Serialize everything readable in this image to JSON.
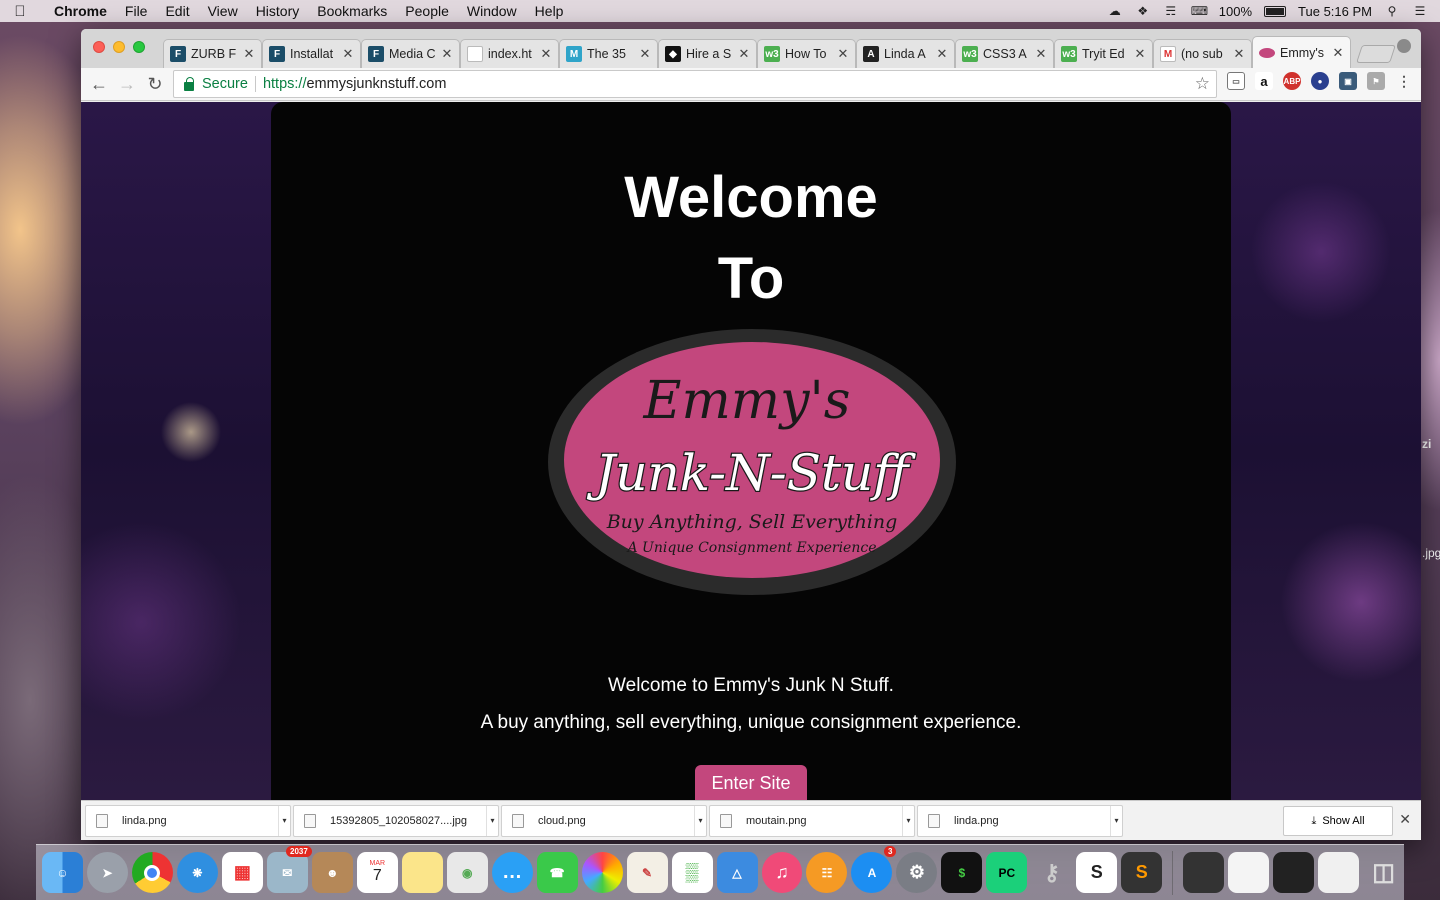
{
  "menubar": {
    "app_name": "Chrome",
    "items": [
      "File",
      "Edit",
      "View",
      "History",
      "Bookmarks",
      "People",
      "Window",
      "Help"
    ],
    "battery": "100%",
    "clock": "Tue 5:16 PM"
  },
  "tabs": [
    {
      "title": "ZURB F",
      "icon": "foundation-icon",
      "color": "#1b4d68",
      "glyph": "F"
    },
    {
      "title": "Installat",
      "icon": "foundation-icon",
      "color": "#1b4d68",
      "glyph": "F"
    },
    {
      "title": "Media C",
      "icon": "foundation-icon",
      "color": "#1b4d68",
      "glyph": "F"
    },
    {
      "title": "index.ht",
      "icon": "page-icon",
      "color": "#ffffff",
      "glyph": ""
    },
    {
      "title": "The 35",
      "icon": "m-icon",
      "color": "#2fa4c9",
      "glyph": "M"
    },
    {
      "title": "Hire a S",
      "icon": "diamond-icon",
      "color": "#111111",
      "glyph": "◆"
    },
    {
      "title": "How To",
      "icon": "w3schools-icon",
      "color": "#4caf50",
      "glyph": "w3"
    },
    {
      "title": "Linda A",
      "icon": "angular-icon",
      "color": "#222222",
      "glyph": "A"
    },
    {
      "title": "CSS3 A",
      "icon": "w3schools-icon",
      "color": "#4caf50",
      "glyph": "w3"
    },
    {
      "title": "Tryit Ed",
      "icon": "w3schools-icon",
      "color": "#4caf50",
      "glyph": "w3"
    },
    {
      "title": "(no sub",
      "icon": "gmail-icon",
      "color": "#ffffff",
      "glyph": "M"
    },
    {
      "title": "Emmy's",
      "icon": "emmys-icon",
      "color": "#c3477d",
      "glyph": "",
      "active": true
    }
  ],
  "toolbar": {
    "secure_label": "Secure",
    "url_scheme": "https://",
    "url_host": "emmysjunknstuff.com"
  },
  "page": {
    "welcome_line1": "Welcome",
    "welcome_line2": "To",
    "logo": {
      "name": "Emmy's",
      "title": "Junk-N-Stuff",
      "slogan1": "Buy Anything, Sell Everything",
      "slogan2": "A Unique Consignment Experience"
    },
    "tagline1": "Welcome to Emmy's Junk N Stuff.",
    "tagline2": "A buy anything, sell everything, unique consignment experience.",
    "enter_label": "Enter Site",
    "accent_color": "#c3477d"
  },
  "downloads": {
    "items": [
      "linda.png",
      "15392805_102058027....jpg",
      "cloud.png",
      "moutain.png",
      "linda.png"
    ],
    "show_all": "Show All"
  },
  "dock": {
    "mail_badge": "2037",
    "calendar_month": "MAR",
    "calendar_day": "7",
    "appstore_badge": "3"
  },
  "desktop_edge": {
    "label1": "zi",
    "label2": ".jpg"
  }
}
